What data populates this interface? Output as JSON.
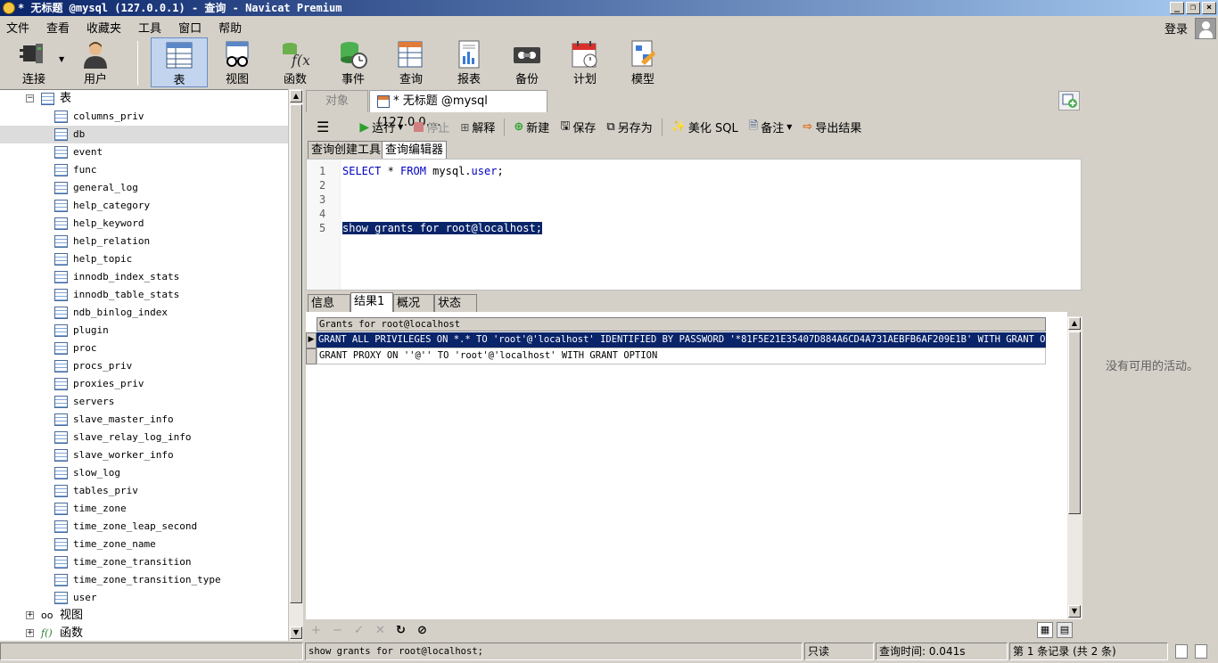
{
  "window": {
    "title": "* 无标题 @mysql (127.0.0.1) - 查询 - Navicat Premium"
  },
  "menu": {
    "items": [
      "文件",
      "查看",
      "收藏夹",
      "工具",
      "窗口",
      "帮助"
    ],
    "login": "登录"
  },
  "toolbar": {
    "connect": "连接",
    "user": "用户",
    "table": "表",
    "view": "视图",
    "function": "函数",
    "event": "事件",
    "query": "查询",
    "report": "报表",
    "backup": "备份",
    "schedule": "计划",
    "model": "模型"
  },
  "tree": {
    "tables_label": "表",
    "tables": [
      "columns_priv",
      "db",
      "event",
      "func",
      "general_log",
      "help_category",
      "help_keyword",
      "help_relation",
      "help_topic",
      "innodb_index_stats",
      "innodb_table_stats",
      "ndb_binlog_index",
      "plugin",
      "proc",
      "procs_priv",
      "proxies_priv",
      "servers",
      "slave_master_info",
      "slave_relay_log_info",
      "slave_worker_info",
      "slow_log",
      "tables_priv",
      "time_zone",
      "time_zone_leap_second",
      "time_zone_name",
      "time_zone_transition",
      "time_zone_transition_type",
      "user"
    ],
    "selected": "db",
    "views_label": "视图",
    "functions_label": "函数"
  },
  "tabs": {
    "objects": "对象",
    "query": "* 无标题 @mysql (127.0.0...."
  },
  "edit_toolbar": {
    "run": "运行",
    "stop": "停止",
    "explain": "解释",
    "new": "新建",
    "save": "保存",
    "save_as": "另存为",
    "beautify": "美化 SQL",
    "note": "备注",
    "export": "导出结果"
  },
  "subtabs": {
    "builder": "查询创建工具",
    "editor": "查询编辑器"
  },
  "editor": {
    "line_numbers": [
      "1",
      "2",
      "3",
      "4",
      "5"
    ],
    "line1": {
      "kw1": "SELECT",
      "mid": " * ",
      "kw2": "FROM",
      "obj": " mysql.",
      "tbl": "user",
      "end": ";"
    },
    "line5": "show grants for root@localhost;"
  },
  "result_tabs": [
    "信息",
    "结果1",
    "概况",
    "状态"
  ],
  "grid": {
    "header": "Grants for root@localhost",
    "rows": [
      "GRANT ALL PRIVILEGES ON *.* TO 'root'@'localhost' IDENTIFIED BY PASSWORD '*81F5E21E35407D884A6CD4A731AEBFB6AF209E1B' WITH GRANT OPTION",
      "GRANT PROXY ON ''@'' TO 'root'@'localhost' WITH GRANT OPTION"
    ]
  },
  "activity": "没有可用的活动。",
  "status": {
    "sql": "show grants for root@localhost;",
    "readonly": "只读",
    "query_time": "查询时间: 0.041s",
    "records": "第 1 条记录 (共 2 条)"
  }
}
